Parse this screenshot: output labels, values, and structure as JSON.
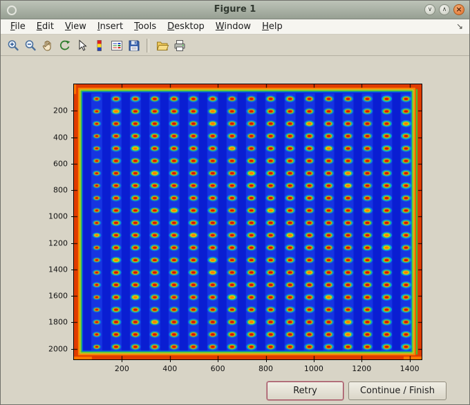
{
  "window": {
    "title": "Figure 1"
  },
  "window_controls": {
    "minimize_glyph": "∨",
    "maximize_glyph": "∧",
    "close_glyph": "×"
  },
  "menu": {
    "items": [
      {
        "label": "File"
      },
      {
        "label": "Edit"
      },
      {
        "label": "View"
      },
      {
        "label": "Insert"
      },
      {
        "label": "Tools"
      },
      {
        "label": "Desktop"
      },
      {
        "label": "Window"
      },
      {
        "label": "Help"
      }
    ],
    "dock_glyph": "↘"
  },
  "toolbar": {
    "icons": [
      {
        "id": "zoom-in",
        "name": "zoom-in-icon"
      },
      {
        "id": "zoom-out",
        "name": "zoom-out-icon"
      },
      {
        "id": "pan",
        "name": "pan-hand-icon"
      },
      {
        "id": "rotate-3d",
        "name": "rotate-3d-icon"
      },
      {
        "id": "data-cursor",
        "name": "data-cursor-icon"
      },
      {
        "id": "colorbar",
        "name": "insert-colorbar-icon"
      },
      {
        "id": "legend",
        "name": "insert-legend-icon"
      },
      {
        "id": "save",
        "name": "save-figure-icon"
      },
      {
        "id": "separator",
        "name": "toolbar-separator"
      },
      {
        "id": "open",
        "name": "open-folder-icon"
      },
      {
        "id": "print",
        "name": "print-icon"
      }
    ]
  },
  "buttons": {
    "retry": "Retry",
    "continue_finish": "Continue / Finish"
  },
  "chart_data": {
    "type": "heatmap",
    "title": "",
    "description": "Microarray plate scan displayed with jet colormap: dense regular grid of red/orange spots with green-cyan halos on deep blue background; saturated red-orange band around the plate edges",
    "x_ticks": [
      200,
      400,
      600,
      800,
      1000,
      1200,
      1400
    ],
    "y_ticks": [
      200,
      400,
      600,
      800,
      1000,
      1200,
      1400,
      1600,
      1800,
      2000
    ],
    "x_range": [
      0,
      1450
    ],
    "y_range": [
      0,
      2080
    ],
    "grid": {
      "rows": 21,
      "cols": 17,
      "x_start": 95,
      "x_end": 1385,
      "y_start": 110,
      "y_end": 1985
    },
    "colors": {
      "background": "#0a1ed2",
      "spot_core": "#d31000",
      "spot_ring": "#ffa200",
      "spot_halo": "#1ee650",
      "border_outer": "#e03c00",
      "border_mid": "#ff8800",
      "border_inner_yellow": "#ffee00",
      "border_inner_green": "#44dd22"
    }
  }
}
